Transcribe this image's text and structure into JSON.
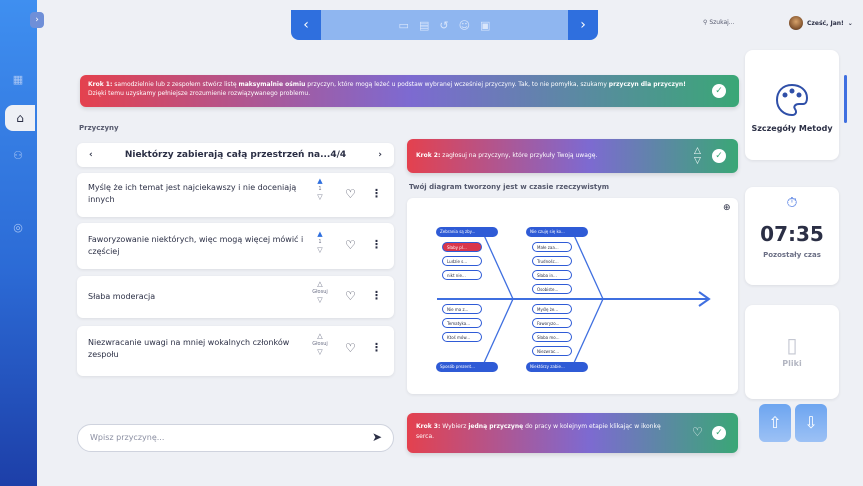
{
  "topbar": {
    "prev": "‹",
    "next": "›",
    "tool_icons": [
      "screen-icon",
      "chat-icon",
      "undo-icon",
      "smile-icon",
      "save-icon"
    ]
  },
  "search": {
    "label": "Szukaj..."
  },
  "user": {
    "greeting": "Cześć, Jan!"
  },
  "step1": {
    "prefix": "Krok 1:",
    "t1": " samodzielnie lub z zespołem stwórz listę ",
    "b1": "maksymalnie ośmiu",
    "t2": " przyczyn, które mogą leżeć u podstaw wybranej wcześniej przyczyny. Tak, to nie pomyłka, szukamy ",
    "b2": "przyczyn dla przyczyn!",
    "t3": " Dzięki temu uzyskamy pełniejsze zrozumienie rozwiązywanego problemu."
  },
  "causes": {
    "title": "Przyczyny",
    "pager": {
      "label": "Niektórzy zabierają całą przestrzeń na...",
      "count": "4/4"
    },
    "items": [
      {
        "text": "Myślę że ich temat jest najciekawszy i nie doceniają innych",
        "votes": "1"
      },
      {
        "text": "Faworyzowanie niektórych, więc mogą więcej mówić i częściej",
        "votes": "1"
      },
      {
        "text": "Słaba moderacja",
        "votes": "Głosuj"
      },
      {
        "text": "Niezwracanie uwagi na mniej wokalnych członków zespołu",
        "votes": "Głosuj"
      }
    ],
    "input_placeholder": "Wpisz przyczynę..."
  },
  "step2": {
    "prefix": "Krok 2:",
    "text": " zagłosuj na przyczyny, które przykuły Twoją uwagę."
  },
  "diagram": {
    "title": "Twój diagram tworzony jest w czasie rzeczywistym",
    "top_left": {
      "head": "Zebrania są zby...",
      "items": [
        "Słaby pl...",
        "Ludzie s...",
        "nikt nie..."
      ]
    },
    "top_right": {
      "head": "Nie czuję się ko...",
      "items": [
        "Małe zaa...",
        "Trudnośc...",
        "Słaba in...",
        "Osobiste..."
      ]
    },
    "bottom_left": {
      "head": "Sposób prezent...",
      "items": [
        "Nie ma z...",
        "Tematyka...",
        "Ktoś mów..."
      ]
    },
    "bottom_right": {
      "head": "Niektórzy zabie...",
      "items": [
        "Myślę że...",
        "Faworyzo...",
        "Słaba mo...",
        "Niezwrac..."
      ]
    }
  },
  "step3": {
    "prefix": "Krok 3:",
    "t1": " Wybierz ",
    "b1": "jedną przyczynę",
    "t2": " do pracy w kolejnym etapie klikając w ikonkę serca."
  },
  "side": {
    "method": "Szczegóły Metody",
    "time": "07:35",
    "time_label": "Pozostały czas",
    "files": "Pliki"
  }
}
